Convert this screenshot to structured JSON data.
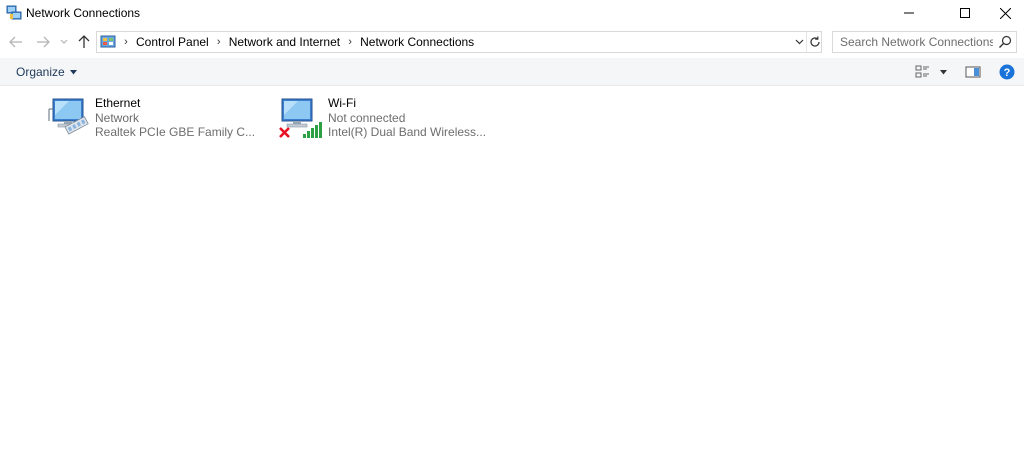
{
  "window": {
    "title": "Network Connections"
  },
  "address_bar": {
    "breadcrumbs": [
      "Control Panel",
      "Network and Internet",
      "Network Connections"
    ]
  },
  "search": {
    "placeholder": "Search Network Connections"
  },
  "toolbar": {
    "organize_label": "Organize"
  },
  "connections": [
    {
      "name": "Ethernet",
      "status": "Network",
      "device": "Realtek PCIe GBE Family C...",
      "icon": "ethernet-adapter-icon"
    },
    {
      "name": "Wi-Fi",
      "status": "Not connected",
      "device": "Intel(R) Dual Band Wireless...",
      "icon": "wifi-adapter-icon"
    }
  ],
  "colors": {
    "accent": "#1e395b",
    "help_blue": "#1a73d9",
    "error_red": "#e81123",
    "signal_green": "#2ea043",
    "secondary_text": "#6d6d6d"
  }
}
